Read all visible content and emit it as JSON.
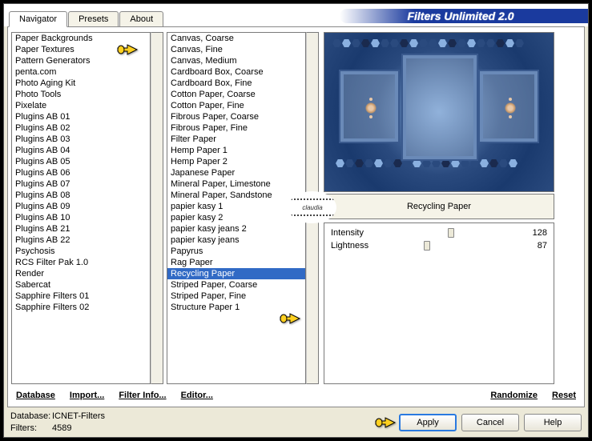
{
  "app_title": "Filters Unlimited 2.0",
  "tabs": {
    "navigator": "Navigator",
    "presets": "Presets",
    "about": "About"
  },
  "cat_list": [
    "Paper Backgrounds",
    "Paper Textures",
    "Pattern Generators",
    "penta.com",
    "Photo Aging Kit",
    "Photo Tools",
    "Pixelate",
    "Plugins AB 01",
    "Plugins AB 02",
    "Plugins AB 03",
    "Plugins AB 04",
    "Plugins AB 05",
    "Plugins AB 06",
    "Plugins AB 07",
    "Plugins AB 08",
    "Plugins AB 09",
    "Plugins AB 10",
    "Plugins AB 21",
    "Plugins AB 22",
    "Psychosis",
    "RCS Filter Pak 1.0",
    "Render",
    "Sabercat",
    "Sapphire Filters 01",
    "Sapphire Filters 02"
  ],
  "filter_list": [
    "Canvas, Coarse",
    "Canvas, Fine",
    "Canvas, Medium",
    "Cardboard Box, Coarse",
    "Cardboard Box, Fine",
    "Cotton Paper, Coarse",
    "Cotton Paper, Fine",
    "Fibrous Paper, Coarse",
    "Fibrous Paper, Fine",
    "Filter Paper",
    "Hemp Paper 1",
    "Hemp Paper 2",
    "Japanese Paper",
    "Mineral Paper, Limestone",
    "Mineral Paper, Sandstone",
    "papier kasy 1",
    "papier kasy 2",
    "papier kasy jeans 2",
    "papier kasy jeans",
    "Papyrus",
    "Rag Paper",
    "Recycling Paper",
    "Striped Paper, Coarse",
    "Striped Paper, Fine",
    "Structure Paper 1"
  ],
  "filter_sel": "Recycling Paper",
  "selected_filter_label": "Recycling Paper",
  "params": [
    {
      "name": "Intensity",
      "value": 128,
      "pos_pct": 50
    },
    {
      "name": "Lightness",
      "value": 87,
      "pos_pct": 34
    }
  ],
  "link_btns": {
    "database": "Database",
    "import": "Import...",
    "filter_info": "Filter Info...",
    "editor": "Editor...",
    "randomize": "Randomize",
    "reset": "Reset"
  },
  "footer": {
    "db_label": "Database:",
    "db_value": "ICNET-Filters",
    "flt_label": "Filters:",
    "flt_value": "4589",
    "apply": "Apply",
    "cancel": "Cancel",
    "help": "Help"
  },
  "logo_text": "claudia"
}
